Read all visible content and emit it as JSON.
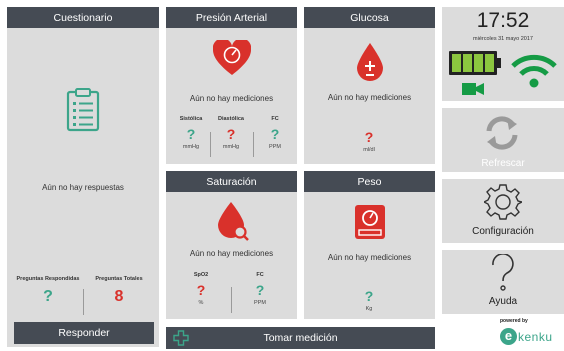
{
  "cuestionario": {
    "title": "Cuestionario",
    "message": "Aún no hay respuestas",
    "stats": [
      {
        "label": "Preguntas Respondidas",
        "value": "?"
      },
      {
        "label": "Preguntas Totales",
        "value": "8"
      }
    ],
    "button": "Responder"
  },
  "presion": {
    "title": "Presión Arterial",
    "message": "Aún no hay mediciones",
    "columns": [
      {
        "label": "Sistólica",
        "value": "?",
        "unit": "mmHg"
      },
      {
        "label": "Diastólica",
        "value": "?",
        "unit": "mmHg"
      },
      {
        "label": "FC",
        "value": "?",
        "unit": "PPM"
      }
    ]
  },
  "glucosa": {
    "title": "Glucosa",
    "message": "Aún no hay mediciones",
    "value": "?",
    "unit": "ml/dl"
  },
  "saturacion": {
    "title": "Saturación",
    "message": "Aún no hay mediciones",
    "columns": [
      {
        "label": "SpO2",
        "value": "?",
        "unit": "%"
      },
      {
        "label": "FC",
        "value": "?",
        "unit": "PPM"
      }
    ]
  },
  "peso": {
    "title": "Peso",
    "message": "Aún no hay mediciones",
    "value": "?",
    "unit": "Kg"
  },
  "tomar": {
    "label": "Tomar medición"
  },
  "status": {
    "time": "17:52",
    "date": "miércoles 31 mayo 2017",
    "battery_level": 1.0
  },
  "refrescar": {
    "label": "Refrescar"
  },
  "configuracion": {
    "label": "Configuración"
  },
  "ayuda": {
    "label": "Ayuda"
  },
  "brand": {
    "powered_by": "powered by",
    "name": "ekenku",
    "name_rest": "kenku",
    "name_initial": "e"
  },
  "colors": {
    "header": "#454b54",
    "panel": "#dcdcdc",
    "red": "#d9312b",
    "teal": "#3ca58a",
    "battery": "#8cc63f",
    "wifi": "#159b45"
  },
  "icons": [
    "clipboard-icon",
    "heart-monitor-icon",
    "blood-drop-icon",
    "saturation-drop-icon",
    "scale-icon",
    "plus-icon",
    "battery-icon",
    "wifi-icon",
    "video-camera-icon",
    "refresh-icon",
    "gear-icon",
    "question-icon"
  ]
}
